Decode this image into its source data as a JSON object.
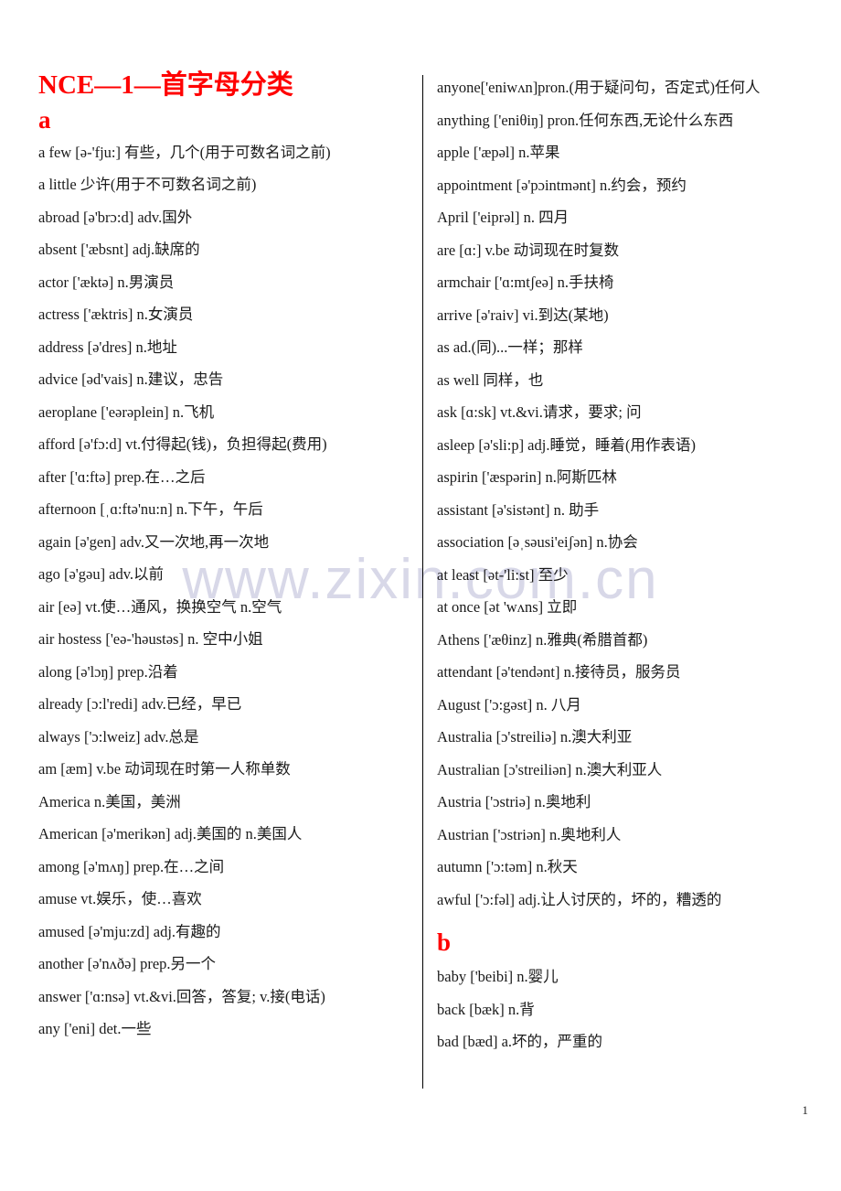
{
  "document": {
    "title": "NCE—1—首字母分类",
    "page_number": "1",
    "watermark": "www.zixin.com.cn"
  },
  "left_column": {
    "letter_heading": "a",
    "entries": [
      "a few [ə-'fju:]  有些，几个(用于可数名词之前)",
      "a little  少许(用于不可数名词之前)",
      "abroad [ə'brɔ:d] adv.国外",
      "absent    ['æbsnt] adj.缺席的",
      "actor ['æktə] n.男演员",
      "actress ['æktris] n.女演员",
      "address [ə'dres] n.地址",
      "advice [əd'vais] n.建议，忠告",
      "aeroplane    ['eərəplein] n.飞机",
      "afford [ə'fɔ:d] vt.付得起(钱)，负担得起(费用)",
      "after    ['ɑ:ftə] prep.在…之后",
      "afternoon    [ˌɑ:ftə'nu:n] n.下午，午后",
      "again    [ə'gen] adv.又一次地,再一次地",
      "ago [ə'gəu] adv.以前",
      "air [eə] vt.使…通风，换换空气 n.空气",
      "air hostess ['eə-'həustəs] n. 空中小姐",
      "along    [ə'lɔŋ] prep.沿着",
      "already [ɔ:l'redi] adv.已经，早已",
      "always    ['ɔ:lweiz] adv.总是",
      "am [æm] v.be 动词现在时第一人称单数",
      "America n.美国，美洲",
      "American [ə'merikən] adj.美国的 n.美国人",
      "among [ə'mʌŋ] prep.在…之间",
      "amuse vt.娱乐，使…喜欢",
      "amused [ə'mju:zd] adj.有趣的",
      "another    [ə'nʌðə] prep.另一个",
      "answer ['ɑ:nsə] vt.&vi.回答，答复; v.接(电话)",
      "any    ['eni] det.一些"
    ]
  },
  "right_column": {
    "entries_before_heading": [
      "anyone['eniwʌn]pron.(用于疑问句，否定式)任何人",
      "anything ['eniθiŋ] pron.任何东西,无论什么东西",
      "apple    ['æpəl] n.苹果",
      "appointment [ə'pɔintmənt] n.约会，预约",
      "April    ['eiprəl] n. 四月",
      "are [ɑ:] v.be 动词现在时复数",
      "armchair ['ɑ:mtʃeə] n.手扶椅",
      "arrive    [ə'raiv] vi.到达(某地)",
      "as ad.(同)...一样；那样",
      "as well  同样，也",
      "ask    [ɑ:sk] vt.&vi.请求，要求; 问",
      "asleep [ə'sli:p] adj.睡觉，睡着(用作表语)",
      "aspirin    ['æspərin] n.阿斯匹林",
      "assistant    [ə'sistənt] n. 助手",
      "association    [əˌsəusi'eiʃən] n.协会",
      "at least [ət-'li:st]  至少",
      "at once [ət 'wʌns]  立即",
      "Athens ['æθinz] n.雅典(希腊首都)",
      "attendant [ə'tendənt] n.接待员，服务员",
      "August    ['ɔ:gəst] n. 八月",
      "Australia    [ɔ'streiliə] n.澳大利亚",
      "Australian    [ɔ'streiliən] n.澳大利亚人",
      "Austria    ['ɔstriə] n.奥地利",
      "Austrian    ['ɔstriən] n.奥地利人",
      "autumn    ['ɔ:təm] n.秋天",
      "awful    ['ɔ:fəl] adj.让人讨厌的，坏的，糟透的"
    ],
    "letter_heading": "b",
    "entries_after_heading": [
      "baby    ['beibi] n.婴儿",
      "back [bæk] n.背",
      "bad    [bæd] a.坏的，严重的"
    ]
  }
}
